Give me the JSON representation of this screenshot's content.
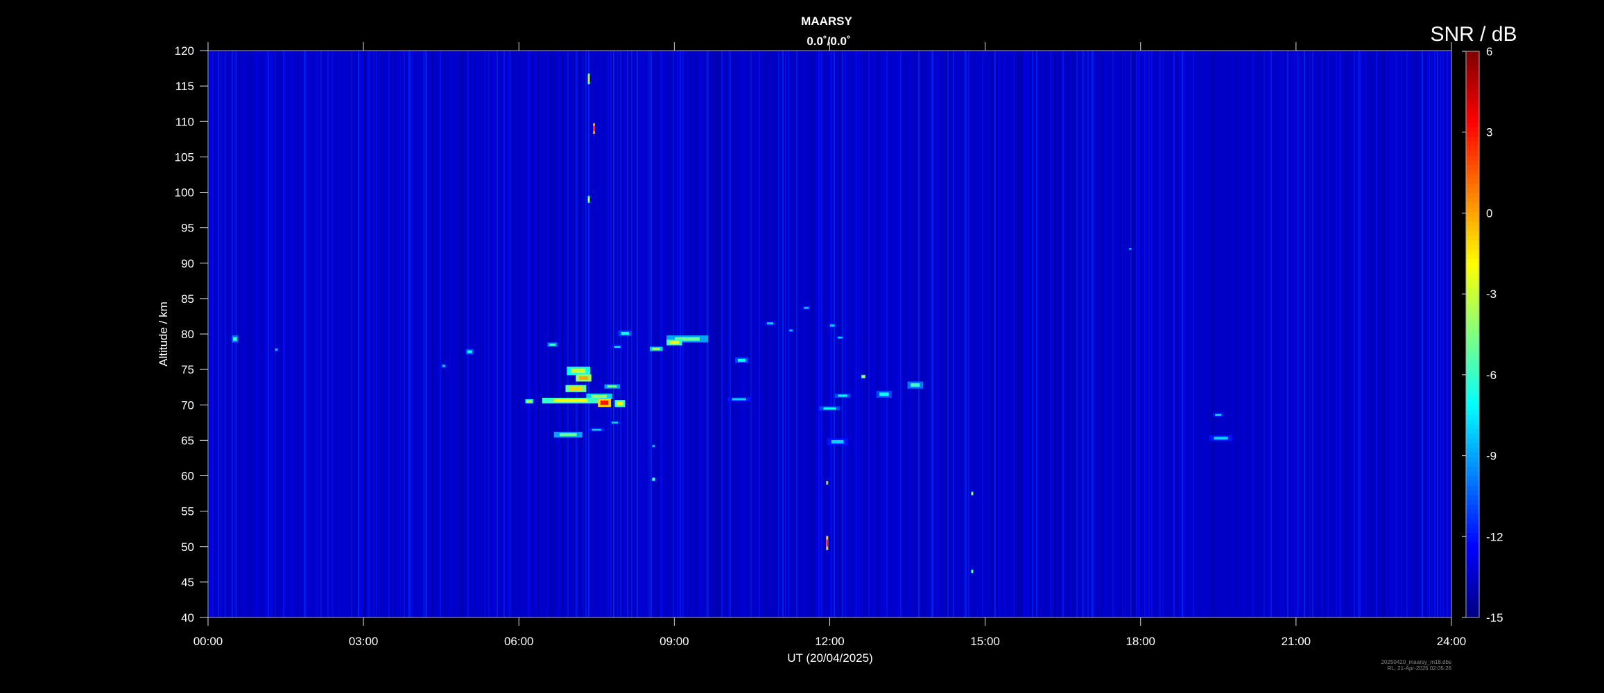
{
  "chart_data": {
    "type": "heatmap",
    "title": "MAARSY",
    "subtitle": "0.0˚/0.0˚",
    "xlabel": "UT (20/04/2025)",
    "ylabel": "Altitude / km",
    "xlim": [
      0,
      24
    ],
    "ylim": [
      40,
      120
    ],
    "x_ticks": [
      "00:00",
      "03:00",
      "06:00",
      "09:00",
      "12:00",
      "15:00",
      "18:00",
      "21:00",
      "24:00"
    ],
    "y_ticks": [
      40,
      45,
      50,
      55,
      60,
      65,
      70,
      75,
      80,
      85,
      90,
      95,
      100,
      105,
      110,
      115,
      120
    ],
    "colorbar": {
      "label": "SNR / dB",
      "range": [
        -15,
        6
      ],
      "ticks": [
        -15,
        -12,
        -9,
        -6,
        -3,
        0,
        3,
        6
      ],
      "colormap": "jet"
    },
    "background_snr_db": -13.5,
    "echoes": [
      {
        "t": 0.52,
        "alt": 79.3,
        "dt": 0.12,
        "dalt": 1.0,
        "snr": -6
      },
      {
        "t": 1.32,
        "alt": 77.8,
        "dt": 0.08,
        "dalt": 0.6,
        "snr": -8
      },
      {
        "t": 4.55,
        "alt": 75.5,
        "dt": 0.1,
        "dalt": 0.6,
        "snr": -8
      },
      {
        "t": 5.05,
        "alt": 77.5,
        "dt": 0.15,
        "dalt": 0.8,
        "snr": -7
      },
      {
        "t": 6.65,
        "alt": 78.5,
        "dt": 0.2,
        "dalt": 0.6,
        "snr": -6
      },
      {
        "t": 7.15,
        "alt": 74.8,
        "dt": 0.45,
        "dalt": 1.2,
        "snr": -3
      },
      {
        "t": 7.25,
        "alt": 73.8,
        "dt": 0.3,
        "dalt": 1.0,
        "snr": 0
      },
      {
        "t": 7.1,
        "alt": 72.3,
        "dt": 0.4,
        "dalt": 1.0,
        "snr": -1
      },
      {
        "t": 7.55,
        "alt": 71.2,
        "dt": 0.5,
        "dalt": 0.8,
        "snr": -4
      },
      {
        "t": 7.0,
        "alt": 70.6,
        "dt": 1.1,
        "dalt": 0.8,
        "snr": -2
      },
      {
        "t": 7.65,
        "alt": 70.3,
        "dt": 0.25,
        "dalt": 1.2,
        "snr": 3
      },
      {
        "t": 7.95,
        "alt": 70.2,
        "dt": 0.2,
        "dalt": 1.0,
        "snr": -2
      },
      {
        "t": 6.2,
        "alt": 70.5,
        "dt": 0.15,
        "dalt": 0.6,
        "snr": -3
      },
      {
        "t": 7.8,
        "alt": 72.6,
        "dt": 0.3,
        "dalt": 0.6,
        "snr": -5
      },
      {
        "t": 6.95,
        "alt": 65.8,
        "dt": 0.55,
        "dalt": 0.8,
        "snr": -5
      },
      {
        "t": 7.5,
        "alt": 66.5,
        "dt": 0.3,
        "dalt": 0.5,
        "snr": -8
      },
      {
        "t": 7.85,
        "alt": 67.5,
        "dt": 0.2,
        "dalt": 0.5,
        "snr": -8
      },
      {
        "t": 8.05,
        "alt": 80.1,
        "dt": 0.25,
        "dalt": 0.8,
        "snr": -7
      },
      {
        "t": 7.9,
        "alt": 78.2,
        "dt": 0.2,
        "dalt": 0.6,
        "snr": -8
      },
      {
        "t": 8.65,
        "alt": 77.9,
        "dt": 0.25,
        "dalt": 0.6,
        "snr": -4
      },
      {
        "t": 9.25,
        "alt": 79.3,
        "dt": 0.8,
        "dalt": 1.0,
        "snr": -5
      },
      {
        "t": 9.0,
        "alt": 78.8,
        "dt": 0.3,
        "dalt": 0.8,
        "snr": -2
      },
      {
        "t": 10.3,
        "alt": 76.3,
        "dt": 0.25,
        "dalt": 0.8,
        "snr": -7
      },
      {
        "t": 10.25,
        "alt": 70.8,
        "dt": 0.45,
        "dalt": 0.6,
        "snr": -8
      },
      {
        "t": 8.6,
        "alt": 64.2,
        "dt": 0.08,
        "dalt": 0.5,
        "snr": -8
      },
      {
        "t": 8.6,
        "alt": 59.5,
        "dt": 0.06,
        "dalt": 0.5,
        "snr": -4
      },
      {
        "t": 10.85,
        "alt": 81.5,
        "dt": 0.2,
        "dalt": 0.6,
        "snr": -8
      },
      {
        "t": 11.25,
        "alt": 80.5,
        "dt": 0.1,
        "dalt": 0.5,
        "snr": -8
      },
      {
        "t": 11.55,
        "alt": 83.7,
        "dt": 0.15,
        "dalt": 0.5,
        "snr": -8
      },
      {
        "t": 12.05,
        "alt": 81.2,
        "dt": 0.15,
        "dalt": 0.6,
        "snr": -8
      },
      {
        "t": 12.2,
        "alt": 79.5,
        "dt": 0.15,
        "dalt": 0.5,
        "snr": -8
      },
      {
        "t": 12.25,
        "alt": 71.3,
        "dt": 0.3,
        "dalt": 0.6,
        "snr": -7
      },
      {
        "t": 12.0,
        "alt": 69.5,
        "dt": 0.4,
        "dalt": 0.6,
        "snr": -7
      },
      {
        "t": 12.15,
        "alt": 64.8,
        "dt": 0.4,
        "dalt": 1.0,
        "snr": -8
      },
      {
        "t": 12.65,
        "alt": 74.0,
        "dt": 0.08,
        "dalt": 0.5,
        "snr": -3
      },
      {
        "t": 13.05,
        "alt": 71.5,
        "dt": 0.3,
        "dalt": 1.0,
        "snr": -7
      },
      {
        "t": 13.65,
        "alt": 72.8,
        "dt": 0.3,
        "dalt": 1.0,
        "snr": -6
      },
      {
        "t": 11.95,
        "alt": 50.5,
        "dt": 0.04,
        "dalt": 2.0,
        "snr": 3
      },
      {
        "t": 11.95,
        "alt": 59.0,
        "dt": 0.04,
        "dalt": 0.5,
        "snr": 0
      },
      {
        "t": 14.75,
        "alt": 57.5,
        "dt": 0.04,
        "dalt": 0.5,
        "snr": -2
      },
      {
        "t": 14.75,
        "alt": 46.5,
        "dt": 0.04,
        "dalt": 0.5,
        "snr": -3
      },
      {
        "t": 7.45,
        "alt": 109.0,
        "dt": 0.04,
        "dalt": 1.5,
        "snr": 4
      },
      {
        "t": 7.35,
        "alt": 116.0,
        "dt": 0.04,
        "dalt": 1.5,
        "snr": -1
      },
      {
        "t": 7.35,
        "alt": 99.0,
        "dt": 0.04,
        "dalt": 1.0,
        "snr": -2
      },
      {
        "t": 17.8,
        "alt": 92.0,
        "dt": 0.08,
        "dalt": 0.5,
        "snr": -9
      },
      {
        "t": 19.5,
        "alt": 68.6,
        "dt": 0.2,
        "dalt": 0.6,
        "snr": -8
      },
      {
        "t": 19.55,
        "alt": 65.3,
        "dt": 0.45,
        "dalt": 0.8,
        "snr": -8
      }
    ]
  },
  "footer": {
    "line1": "20250420_maarsy_m18.dbs",
    "line2": "RL, 21-Apr-2025 02:05:26"
  }
}
